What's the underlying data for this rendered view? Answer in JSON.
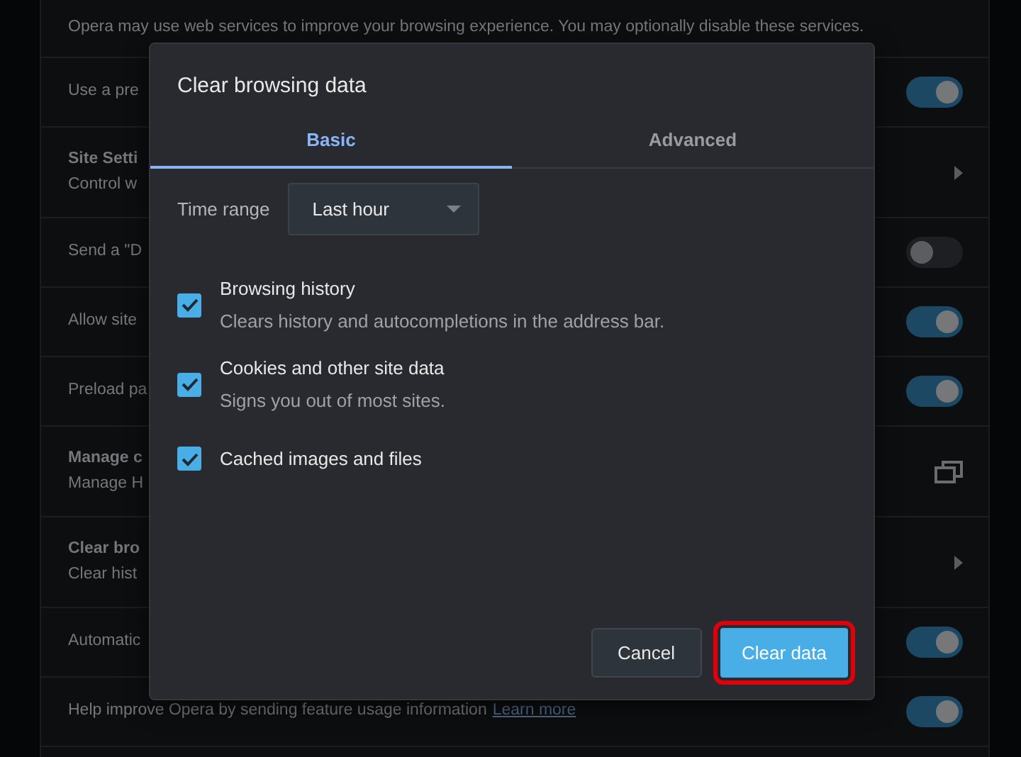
{
  "settings": {
    "intro": "Opera may use web services to improve your browsing experience. You may optionally disable these services.",
    "rows": [
      {
        "kind": "toggle",
        "title": "Use a pre",
        "on": true
      },
      {
        "kind": "link",
        "title": "Site Setti",
        "subtitle": "Control w"
      },
      {
        "kind": "toggle",
        "title": "Send a \"D",
        "on": false
      },
      {
        "kind": "toggle",
        "title": "Allow site",
        "on": true
      },
      {
        "kind": "toggle",
        "title": "Preload pa",
        "on": true
      },
      {
        "kind": "external",
        "title": "Manage c",
        "subtitle": "Manage H"
      },
      {
        "kind": "link",
        "title": "Clear bro",
        "subtitle": "Clear hist"
      },
      {
        "kind": "toggle",
        "title": "Automatic",
        "on": true
      },
      {
        "kind": "toggle",
        "title": "Help improve Opera by sending feature usage information",
        "link": "Learn more",
        "on": true
      }
    ]
  },
  "dialog": {
    "title": "Clear browsing data",
    "tabs": [
      {
        "label": "Basic",
        "selected": true
      },
      {
        "label": "Advanced",
        "selected": false
      }
    ],
    "time_range": {
      "label": "Time range",
      "value": "Last hour"
    },
    "options": [
      {
        "label": "Browsing history",
        "description": "Clears history and autocompletions in the address bar.",
        "checked": true
      },
      {
        "label": "Cookies and other site data",
        "description": "Signs you out of most sites.",
        "checked": true
      },
      {
        "label": "Cached images and files",
        "checked": true
      }
    ],
    "buttons": [
      {
        "label": "Cancel",
        "kind": "secondary"
      },
      {
        "label": "Clear data",
        "kind": "primary",
        "highlighted": true
      }
    ]
  }
}
